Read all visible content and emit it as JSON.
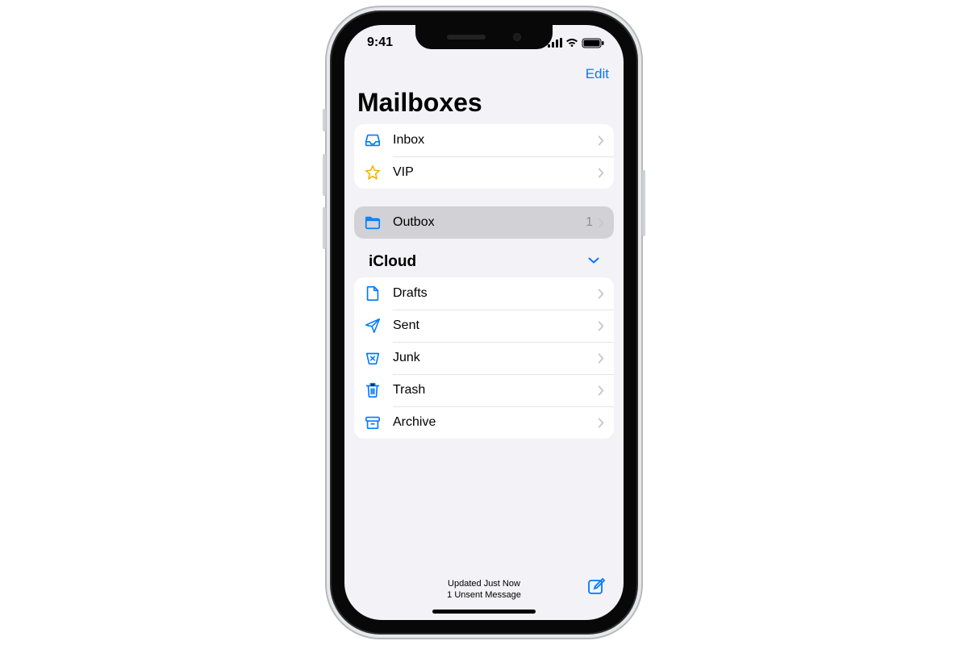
{
  "status": {
    "time": "9:41"
  },
  "nav": {
    "edit": "Edit"
  },
  "title": "Mailboxes",
  "primary": {
    "items": [
      {
        "label": "Inbox",
        "icon": "inbox-icon",
        "iconColor": "#007aff",
        "count": ""
      },
      {
        "label": "VIP",
        "icon": "star-icon",
        "iconColor": "#f0b400",
        "count": ""
      }
    ]
  },
  "outbox": {
    "label": "Outbox",
    "icon": "folder-icon",
    "iconColor": "#007aff",
    "count": "1"
  },
  "section": {
    "title": "iCloud"
  },
  "account": {
    "items": [
      {
        "label": "Drafts",
        "icon": "draft-icon",
        "iconColor": "#007aff"
      },
      {
        "label": "Sent",
        "icon": "sent-icon",
        "iconColor": "#007aff"
      },
      {
        "label": "Junk",
        "icon": "junk-icon",
        "iconColor": "#007aff"
      },
      {
        "label": "Trash",
        "icon": "trash-icon",
        "iconColor": "#007aff"
      },
      {
        "label": "Archive",
        "icon": "archive-icon",
        "iconColor": "#007aff"
      }
    ]
  },
  "toolbar": {
    "status_line1": "Updated Just Now",
    "status_line2": "1 Unsent Message"
  }
}
